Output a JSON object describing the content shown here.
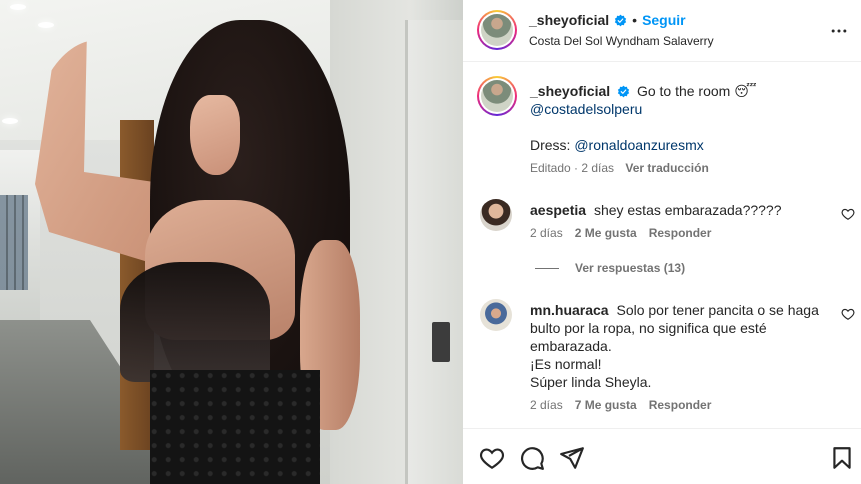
{
  "post": {
    "username": "_sheyoficial",
    "separator": "•",
    "follow_label": "Seguir",
    "location": "Costa Del Sol Wyndham Salaverry"
  },
  "caption": {
    "username": "_sheyoficial",
    "text": "Go to the room 😴",
    "mention1": "@costadelsolperu",
    "dress_label": "Dress: ",
    "mention2": "@ronaldoanzuresmx",
    "edited": "Editado · 2 días",
    "translate": "Ver traducción"
  },
  "comments": [
    {
      "username": "aespetia",
      "text": "shey estas embarazada?????",
      "age": "2 días",
      "likes": "2 Me gusta",
      "reply": "Responder"
    },
    {
      "username": "mn.huaraca",
      "text_line1": "Solo por tener pancita o se haga",
      "text_line2": "bulto por la ropa, no significa que esté",
      "text_line3": "embarazada.",
      "text_line4": "¡Es normal!",
      "text_line5": "Súper linda Sheyla.",
      "age": "2 días",
      "likes": "7 Me gusta",
      "reply": "Responder"
    }
  ],
  "replies_link": "Ver respuestas (13)",
  "icons": {
    "more": "more-horizontal-icon",
    "verified": "verified-badge-icon",
    "like": "heart-icon",
    "comment": "comment-icon",
    "share": "share-icon",
    "save": "bookmark-icon"
  },
  "colors": {
    "accent": "#0095f6",
    "link": "#00376b",
    "muted": "#737373",
    "text": "#262626",
    "verified": "#0095f6"
  }
}
